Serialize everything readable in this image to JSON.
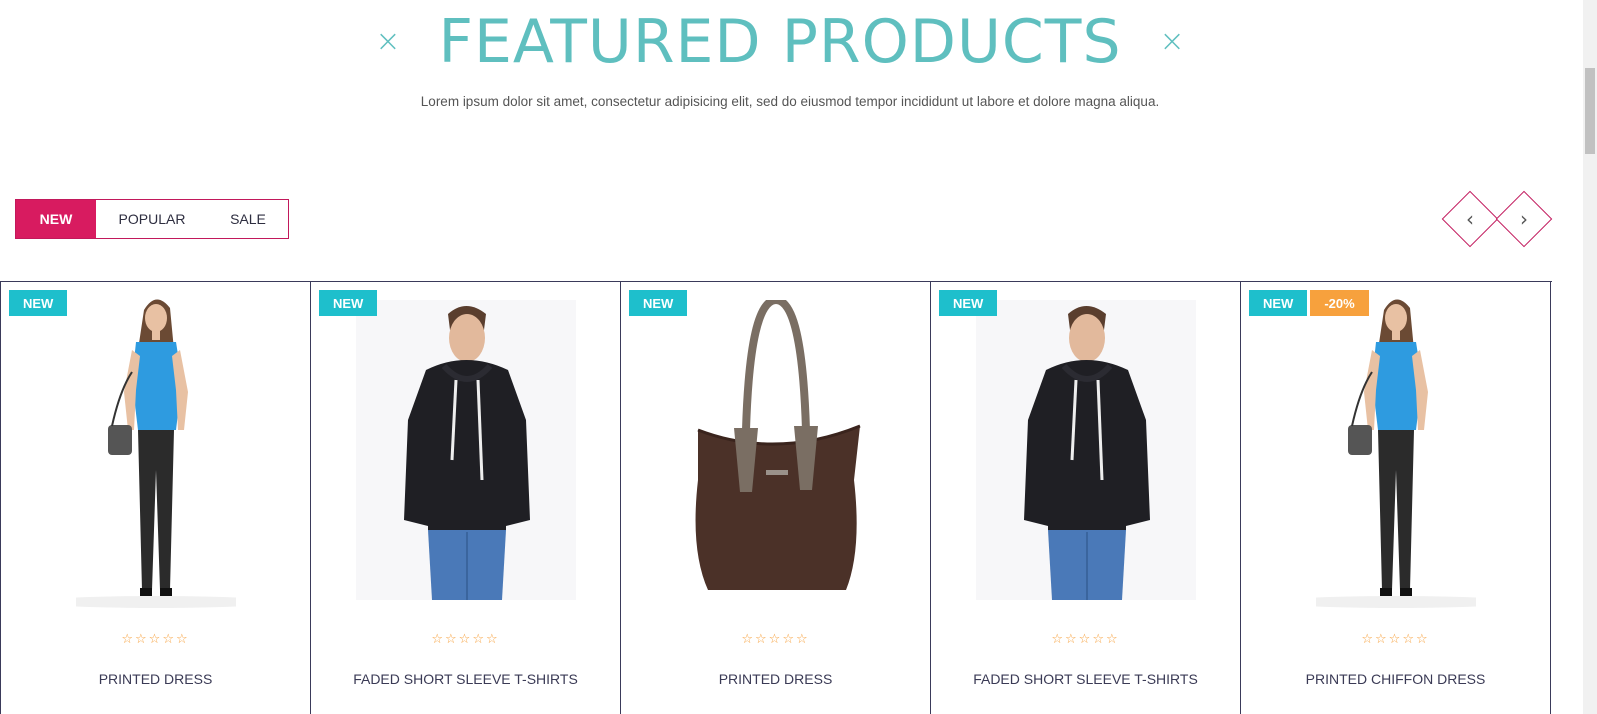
{
  "header": {
    "title": "FEATURED PRODUCTS",
    "decor_left": "×",
    "decor_right": "×",
    "subtitle": "Lorem ipsum dolor sit amet, consectetur adipisicing elit, sed do eiusmod tempor incididunt ut labore et dolore magna aliqua."
  },
  "tabs": [
    {
      "label": "NEW",
      "active": true
    },
    {
      "label": "POPULAR",
      "active": false
    },
    {
      "label": "SALE",
      "active": false
    }
  ],
  "nav": {
    "prev_icon": "‹",
    "next_icon": "›"
  },
  "colors": {
    "accent_teal": "#5fbfbf",
    "accent_pink": "#d81b60",
    "badge_new": "#1ebfcc",
    "badge_sale": "#f7a13d",
    "stars": "#f7a13d"
  },
  "products": [
    {
      "name": "PRINTED DRESS",
      "badges": [
        "NEW"
      ],
      "rating": 0,
      "stars": "☆☆☆☆☆",
      "image": "woman-blue-top"
    },
    {
      "name": "FADED SHORT SLEEVE T-SHIRTS",
      "badges": [
        "NEW"
      ],
      "rating": 0,
      "stars": "☆☆☆☆☆",
      "image": "man-black-hoodie"
    },
    {
      "name": "PRINTED DRESS",
      "badges": [
        "NEW"
      ],
      "rating": 0,
      "stars": "☆☆☆☆☆",
      "image": "brown-handbag"
    },
    {
      "name": "FADED SHORT SLEEVE T-SHIRTS",
      "badges": [
        "NEW"
      ],
      "rating": 0,
      "stars": "☆☆☆☆☆",
      "image": "man-black-hoodie"
    },
    {
      "name": "PRINTED CHIFFON DRESS",
      "badges": [
        "NEW",
        "-20%"
      ],
      "rating": 0,
      "stars": "☆☆☆☆☆",
      "image": "woman-blue-top"
    }
  ]
}
